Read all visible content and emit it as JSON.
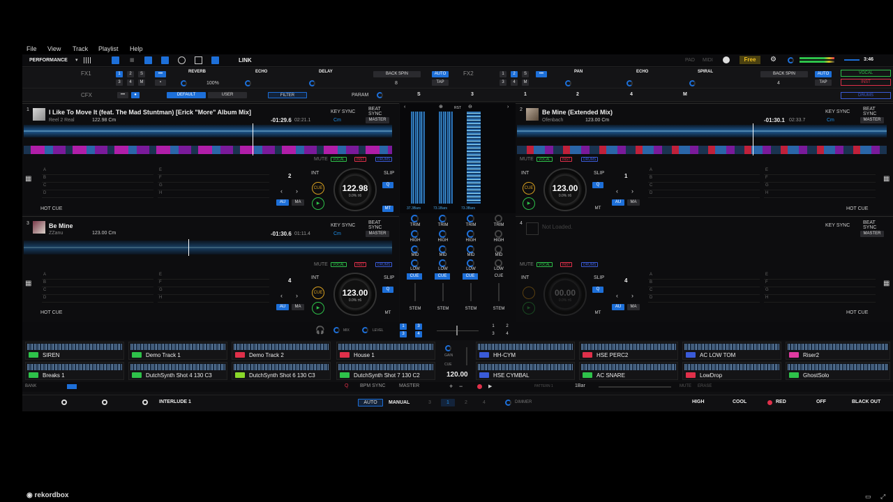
{
  "menu": [
    "File",
    "View",
    "Track",
    "Playlist",
    "Help"
  ],
  "toolbar": {
    "mode": "PERFORMANCE",
    "link": "LINK",
    "pad": "PAD",
    "midi": "MIDI",
    "free": "Free",
    "time": "3:46",
    "zoom": "100%"
  },
  "fx1": {
    "label": "FX1",
    "effects": [
      "REVERB",
      "ECHO",
      "DELAY"
    ],
    "backspin": "BACK SPIN",
    "auto": "AUTO",
    "tap": "TAP",
    "beat": "8",
    "nums": [
      "1",
      "2",
      "3",
      "4",
      "M"
    ]
  },
  "fx2": {
    "label": "FX2",
    "effects": [
      "PAN",
      "ECHO",
      "SPIRAL"
    ],
    "backspin": "BACK SPIN",
    "auto": "AUTO",
    "tap": "TAP",
    "beat": "4"
  },
  "cfx": {
    "label": "CFX",
    "default": "DEFAULT",
    "user": "USER",
    "filter": "FILTER",
    "param": "PARAM",
    "s": "S",
    "three": "3",
    "nums": [
      "1",
      "2",
      "4",
      "M"
    ]
  },
  "stems_right": {
    "vocal": "VOCAL",
    "inst": "INST",
    "drums": "DRUMS"
  },
  "deck1": {
    "num": "1",
    "title": "I Like To Move It (feat. The Mad Stuntman) [Erick \"More\" Album Mix]",
    "artist": "Reel 2 Real",
    "bpm": "122.98 Cm",
    "remain": "-01:29.6",
    "total": "02:21.1",
    "key": "Cm",
    "keysync": "KEY SYNC",
    "beatsync": "BEAT SYNC",
    "master": "MASTER",
    "jog_bpm": "122.98",
    "jog_sub": "0.0% ±6",
    "loop": "2",
    "hotcue": "HOT CUE"
  },
  "deck2": {
    "num": "2",
    "title": "Be Mine (Extended Mix)",
    "artist": "Ofenbach",
    "bpm": "123.00 Cm",
    "remain": "-01:30.1",
    "total": "02:33.7",
    "key": "Cm",
    "keysync": "KEY SYNC",
    "beatsync": "BEAT SYNC",
    "master": "MASTER",
    "jog_bpm": "123.00",
    "jog_sub": "0.0% ±6",
    "loop": "1",
    "hotcue": "HOT CUE"
  },
  "deck3": {
    "num": "3",
    "title": "Be Mine",
    "artist": "ZZanu",
    "bpm": "123.00 Cm",
    "remain": "-01:30.6",
    "total": "01:11.4",
    "key": "Cm",
    "keysync": "KEY SYNC",
    "beatsync": "BEAT SYNC",
    "master": "MASTER",
    "jog_bpm": "123.00",
    "jog_sub": "0.0% ±6",
    "loop": "4",
    "hotcue": "HOT CUE"
  },
  "deck4": {
    "num": "4",
    "title": "Not Loaded.",
    "keysync": "KEY SYNC",
    "beatsync": "BEAT SYNC",
    "master": "MASTER",
    "jog_bpm": "00.00",
    "jog_sub": "0.0% ±6",
    "loop": "4",
    "hotcue": "HOT CUE"
  },
  "deck_labels": {
    "mute": "MUTE",
    "vocal": "VOCAL",
    "inst": "INST",
    "drums": "DRUMS",
    "int": "INT",
    "slip": "SLIP",
    "cue": "CUE",
    "q": "Q",
    "mt": "MT",
    "au": "AU",
    "ma": "MA"
  },
  "hotcues_left": [
    "A",
    "B",
    "C",
    "D"
  ],
  "hotcues_right": [
    "E",
    "F",
    "G",
    "H"
  ],
  "mixer": {
    "trim": "TRIM",
    "high": "HIGH",
    "mid": "MID",
    "low": "LOW",
    "cue": "CUE",
    "stem": "STEM",
    "bars": [
      "37.3Bars",
      "73.1Bars",
      "73.3Bars"
    ],
    "rst": "RST",
    "mix": "MIX",
    "level": "LEVEL",
    "gain": "GAIN"
  },
  "samplers": [
    {
      "name": "SIREN",
      "color": "#2ec24a"
    },
    {
      "name": "Demo Track 1",
      "color": "#2ec24a"
    },
    {
      "name": "Demo Track 2",
      "color": "#e0304a"
    },
    {
      "name": "House 1",
      "color": "#e0304a"
    },
    {
      "name": "HH-CYM",
      "color": "#3a5bd8"
    },
    {
      "name": "HSE PERC2",
      "color": "#e0304a"
    },
    {
      "name": "AC LOW TOM",
      "color": "#3a5bd8"
    },
    {
      "name": "Riser2",
      "color": "#e03aa0"
    },
    {
      "name": "Breaks 1",
      "color": "#2ec24a"
    },
    {
      "name": "DutchSynth Shot 4 130 C3",
      "color": "#2ec24a"
    },
    {
      "name": "DutchSynth Shot 6 130 C3",
      "color": "#8ad82a"
    },
    {
      "name": "DutchSynth Shot 7 130 C2",
      "color": "#2ec24a"
    },
    {
      "name": "HSE CYMBAL",
      "color": "#3a5bd8"
    },
    {
      "name": "AC SNARE",
      "color": "#2ec24a"
    },
    {
      "name": "LowDrop",
      "color": "#e0304a"
    },
    {
      "name": "GhostSolo",
      "color": "#2ec24a"
    }
  ],
  "sampler_ctrl": {
    "bank": "BANK",
    "bpm_sync": "BPM SYNC",
    "master": "MASTER",
    "bpm": "120.00",
    "pattern": "PATTERN 1",
    "bar": "1Bar",
    "mute": "MUTE",
    "erase": "ERASE"
  },
  "bottom": {
    "interlude": "INTERLUDE 1",
    "auto": "AUTO",
    "manual": "MANUAL",
    "dimmer": "DIMMER",
    "high": "HIGH",
    "cool": "COOL",
    "red": "RED",
    "off": "OFF",
    "blackout": "BLACK OUT",
    "nums": [
      "3",
      "1",
      "2",
      "4"
    ]
  },
  "brand": "rekordbox"
}
